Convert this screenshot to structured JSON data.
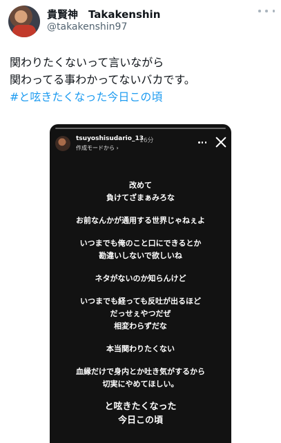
{
  "author": {
    "display_name": "貴賢神　Takakenshin",
    "handle": "@takakenshin97",
    "avatar_icon": "profile-photo"
  },
  "tweet": {
    "text": "関わりたくないって言いながら\n関わってる事わかってないバカです。",
    "hashtag": "#と呟きたくなった今日この頃"
  },
  "story": {
    "username": "tsuyoshisudario_13",
    "time": "16分",
    "subtitle": "作成モードから ›",
    "paragraphs": [
      "改めて\n負けてざまぁみろな",
      "お前なんかが通用する世界じゃねぇよ",
      "いつまでも俺のこと口にできるとか\n勘違いしないで欲しいね",
      "ネタがないのか知らんけど",
      "いつまでも経っても反吐が出るほど\nだっせぇやつだぜ\n相変わらずだな",
      "本当関わりたくない",
      "血縁だけで身内とか吐き気がするから\n切実にやめてほしい。"
    ],
    "closing": "と呟きたくなった\n今日この頃"
  },
  "colors": {
    "hashtag": "#1d9bf0",
    "story_background": "#121212",
    "secondary_text": "#536471"
  }
}
